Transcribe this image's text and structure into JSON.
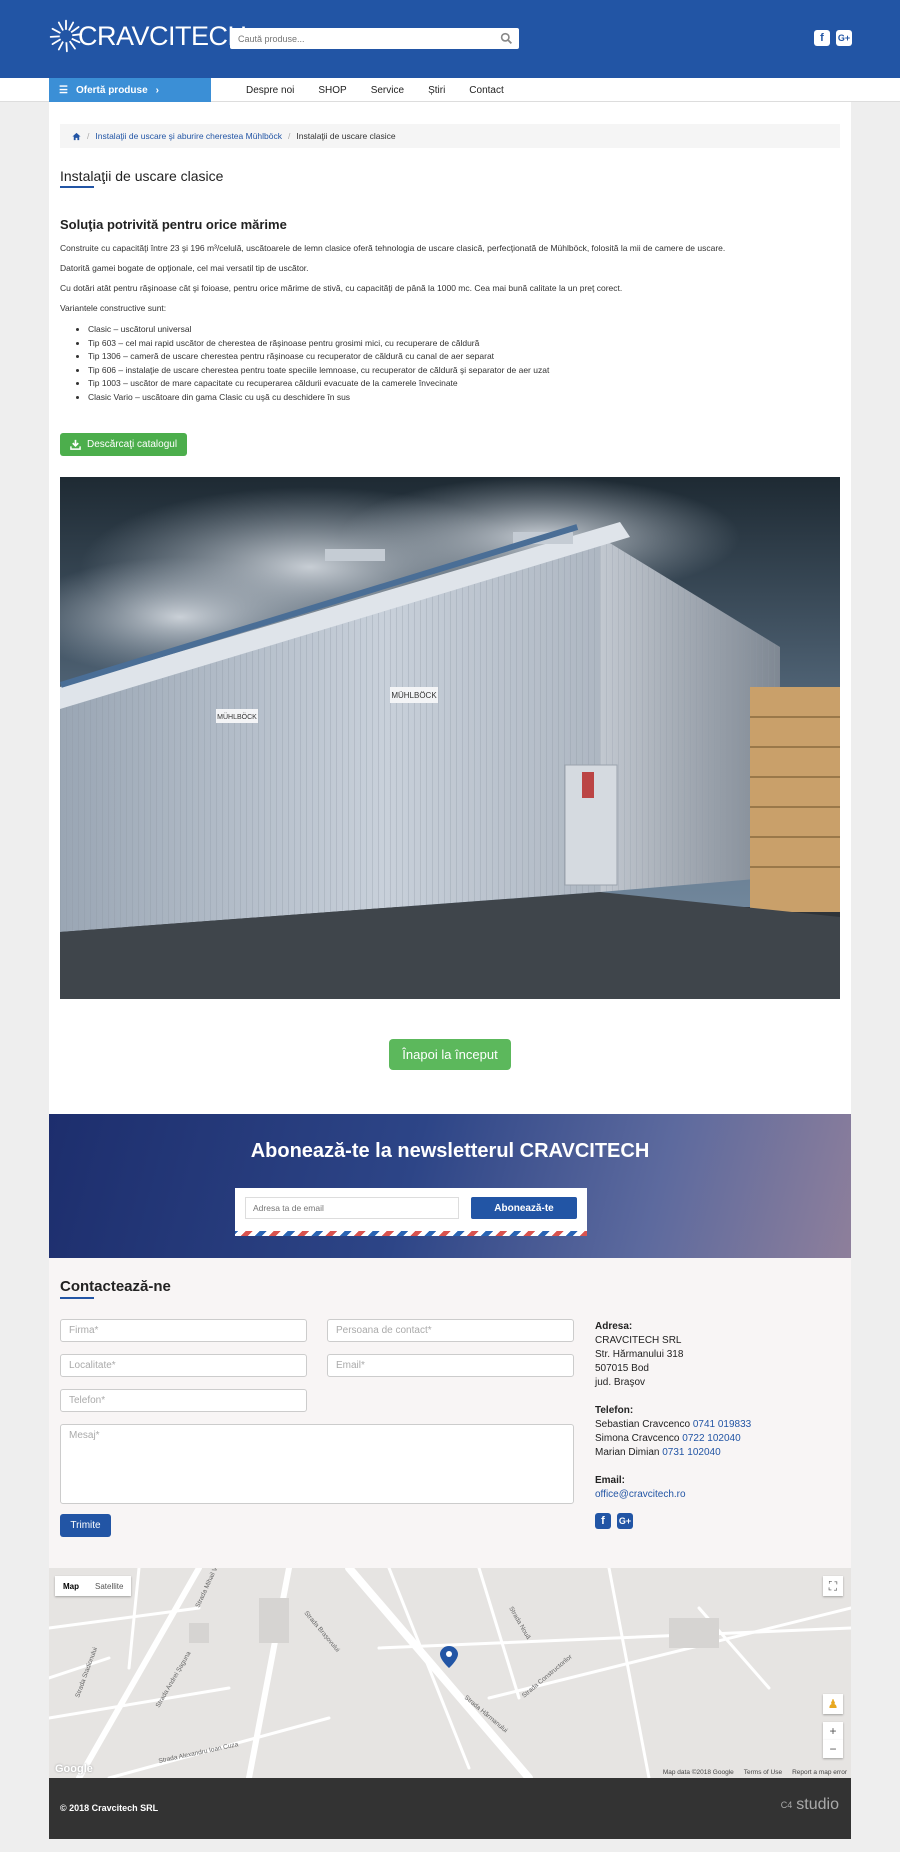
{
  "header": {
    "logo_text": "CRAVCITECH",
    "search_placeholder": "Caută produse...",
    "social": [
      "facebook-icon",
      "google-plus-icon"
    ]
  },
  "nav": {
    "offer_label": "Ofertă produse",
    "items": [
      "Despre noi",
      "SHOP",
      "Service",
      "Știri",
      "Contact"
    ]
  },
  "breadcrumb": {
    "home_icon": "home-icon",
    "level1": "Instalaţii de uscare şi aburire cherestea Mühlböck",
    "current": "Instalaţii de uscare clasice"
  },
  "page": {
    "title": "Instalaţii de uscare clasice",
    "subtitle": "Soluţia potrivită pentru orice mărime",
    "p1": "Construite cu capacităţi între 23 şi 196 m³/celulă, uscătoarele de lemn clasice oferă tehnologia de uscare clasică, perfecţionată de Mühlböck, folosită la mii de camere de uscare.",
    "p2": "Datorită gamei bogate de opţionale, cel mai versatil tip de uscător.",
    "p3": "Cu dotări atât pentru răşinoase cât şi foioase, pentru orice mărime de stivă, cu capacităţi de până la 1000 mc. Cea mai bună calitate la un preţ corect.",
    "p4": "Variantele constructive sunt:",
    "variants": [
      "Clasic – uscătorul universal",
      "Tip 603 – cel mai rapid uscător de cherestea de răşinoase pentru grosimi mici, cu recuperare de căldură",
      "Tip 1306 – cameră de uscare cherestea pentru răşinoase cu recuperator de căldură cu canal de aer separat",
      "Tip 606 – instalaţie de uscare cherestea pentru toate speciile lemnoase, cu recuperator de căldură şi separator de aer uzat",
      "Tip 1003 – uscător de mare capacitate cu recuperarea căldurii evacuate de la camerele învecinate",
      "Clasic Vario – uscătoare din gama Clasic cu uşă cu deschidere în sus"
    ],
    "download_label": "Descărcaţi catalogul",
    "photo_sign": "MÜHLBÖCK",
    "back_label": "Înapoi la început"
  },
  "newsletter": {
    "title": "Abonează-te la newsletterul CRAVCITECH",
    "placeholder": "Adresa ta de email",
    "button": "Abonează-te"
  },
  "contact": {
    "title": "Contactează-ne",
    "fields": {
      "firma": "Firma*",
      "persoana": "Persoana de contact*",
      "localitate": "Localitate*",
      "email": "Email*",
      "telefon": "Telefon*",
      "mesaj": "Mesaj*"
    },
    "send": "Trimite",
    "address_label": "Adresa:",
    "address_lines": [
      "CRAVCITECH SRL",
      "Str. Hărmanului 318",
      "507015 Bod",
      "jud. Braşov"
    ],
    "phone_label": "Telefon:",
    "phones": [
      {
        "name": "Sebastian Cravcenco",
        "number": "0741 019833"
      },
      {
        "name": "Simona Cravcenco",
        "number": "0722 102040"
      },
      {
        "name": "Marian Dimian",
        "number": "0731 102040"
      }
    ],
    "email_label": "Email:",
    "email": "office@cravcitech.ro"
  },
  "map": {
    "tab_map": "Map",
    "tab_satellite": "Satellite",
    "google": "Google",
    "data": "Map data ©2018 Google",
    "terms": "Terms of Use",
    "report": "Report a map error",
    "streets": [
      "Strada Brașovului",
      "Strada Hărmanului",
      "Strada Nouă",
      "Strada Andrei Șaguna",
      "Strada Alexandru Ioan Cuza",
      "Strada Stadionului",
      "Strada Mihail Viteazul",
      "Strada Constructorilor"
    ]
  },
  "footer": {
    "copyright": "© 2018 Cravcitech SRL",
    "studio": "studio",
    "studio_prefix": "C4"
  }
}
